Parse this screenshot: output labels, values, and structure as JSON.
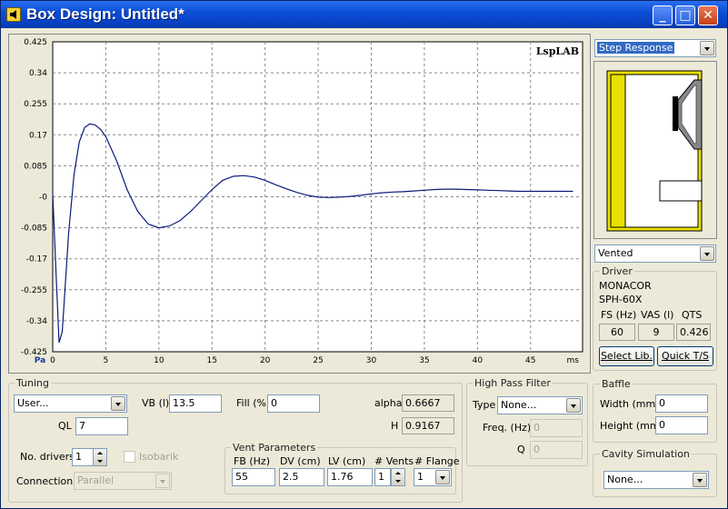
{
  "window": {
    "title": "Box Design: Untitled*",
    "brand": "LspLAB"
  },
  "chart_data": {
    "type": "line",
    "title": "",
    "xlabel": "ms",
    "ylabel": "Pa",
    "xlim": [
      0,
      50
    ],
    "ylim": [
      -0.425,
      0.425
    ],
    "xticks": [
      "0",
      "5",
      "10",
      "15",
      "20",
      "25",
      "30",
      "35",
      "40",
      "45"
    ],
    "yticks": [
      "0.425",
      "0.34",
      "0.255",
      "0.17",
      "0.085",
      "-0",
      "-0.085",
      "-0.17",
      "-0.255",
      "-0.34",
      "-0.425"
    ],
    "series": [
      {
        "color": "#0a1a7a",
        "x": [
          0,
          0.3,
          0.6,
          0.9,
          1.5,
          2,
          2.5,
          3,
          3.5,
          4,
          4.5,
          5,
          6,
          7,
          8,
          9,
          10,
          11,
          12,
          13,
          14,
          15,
          16,
          17,
          18,
          19,
          20,
          21,
          22,
          23,
          24,
          25,
          26,
          27,
          28,
          29,
          30,
          31,
          32,
          33,
          34,
          35,
          36,
          37,
          38,
          39,
          40,
          41,
          42,
          43,
          44,
          45,
          46,
          47,
          48,
          49,
          50,
          51,
          52,
          53,
          54,
          55,
          56
        ],
        "y": [
          0.01,
          -0.2,
          -0.4,
          -0.37,
          -0.1,
          0.06,
          0.15,
          0.19,
          0.2,
          0.197,
          0.185,
          0.165,
          0.1,
          0.02,
          -0.04,
          -0.075,
          -0.085,
          -0.08,
          -0.065,
          -0.04,
          -0.01,
          0.02,
          0.045,
          0.056,
          0.058,
          0.054,
          0.045,
          0.033,
          0.022,
          0.012,
          0.004,
          -0.001,
          -0.002,
          -0.001,
          0.001,
          0.004,
          0.008,
          0.011,
          0.013,
          0.014,
          0.016,
          0.018,
          0.02,
          0.021,
          0.021,
          0.02,
          0.019,
          0.018,
          0.017,
          0.016,
          0.015,
          0.015,
          0.015,
          0.015,
          0.015,
          0.015,
          0.015,
          0.015,
          0.015,
          0.015,
          0.015,
          0.015,
          0.015
        ]
      }
    ]
  },
  "right": {
    "view_select": "Step Response",
    "box_type": "Vented",
    "driver": {
      "legend": "Driver",
      "brand": "MONACOR",
      "model": "SPH-60X",
      "fs_label": "FS (Hz)",
      "vas_label": "VAS (l)",
      "qts_label": "QTS",
      "fs": "60",
      "vas": "9",
      "qts": "0.426",
      "select_lib": "Select Lib.",
      "quick_ts": "Quick T/S"
    }
  },
  "tuning": {
    "legend": "Tuning",
    "mode": "User...",
    "vb_label": "VB (l)",
    "vb": "13.5",
    "fill_label": "Fill (%)",
    "fill": "0",
    "alpha_label": "alpha",
    "alpha": "0.6667",
    "ql_label": "QL",
    "ql": "7",
    "h_label": "H",
    "h": "0.9167",
    "drivers_label": "No. drivers",
    "drivers": "1",
    "isobarik": "Isobarik",
    "connection_label": "Connection",
    "connection": "Parallel"
  },
  "vent": {
    "legend": "Vent Parameters",
    "fb_label": "FB (Hz)",
    "fb": "55",
    "dv_label": "DV (cm)",
    "dv": "2.5",
    "lv_label": "LV (cm)",
    "lv": "1.76",
    "vents_label": "# Vents",
    "vents": "1",
    "flange_label": "# Flange",
    "flange": "1"
  },
  "hpf": {
    "legend": "High Pass Filter",
    "type_label": "Type",
    "type": "None...",
    "freq_label": "Freq. (Hz)",
    "freq": "0",
    "q_label": "Q",
    "q": "0"
  },
  "baffle": {
    "legend": "Baffle",
    "width_label": "Width (mm)",
    "width": "0",
    "height_label": "Height (mm)",
    "height": "0"
  },
  "cavity": {
    "legend": "Cavity Simulation",
    "type": "None..."
  }
}
